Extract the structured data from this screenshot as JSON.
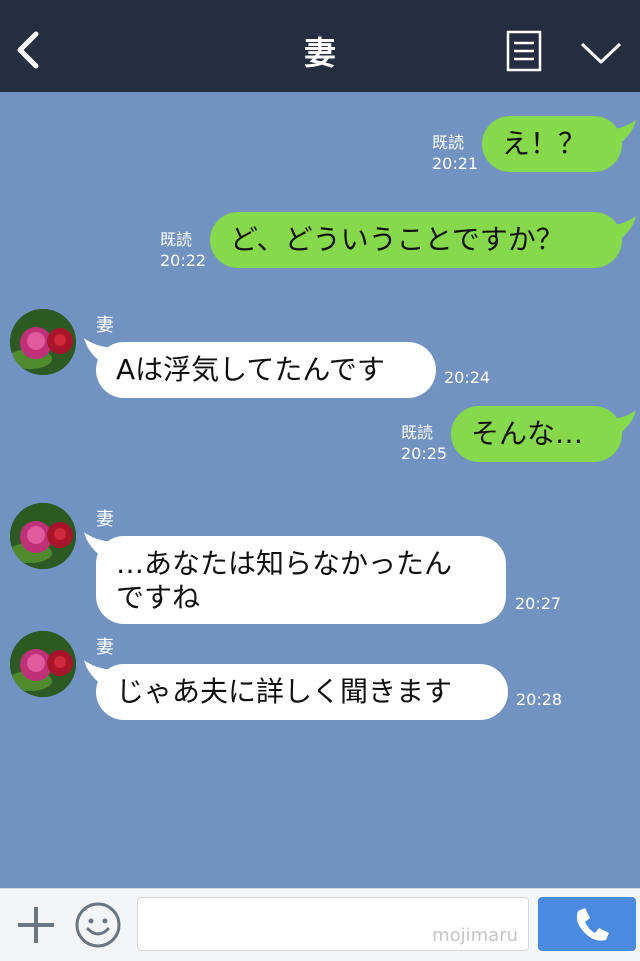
{
  "header": {
    "title": "妻"
  },
  "messages": [
    {
      "dir": "out",
      "text": "え！？",
      "read": "既読",
      "time": "20:21"
    },
    {
      "dir": "out",
      "text": "ど、どういうことですか？",
      "read": "既読",
      "time": "20:22"
    },
    {
      "dir": "in",
      "sender": "妻",
      "text": "Aは浮気してたんです",
      "time": "20:24"
    },
    {
      "dir": "out",
      "text": "そんな…",
      "read": "既読",
      "time": "20:25"
    },
    {
      "dir": "in",
      "sender": "妻",
      "text_line1": "…あなたは知らなかったん",
      "text_line2": "ですね",
      "time": "20:27"
    },
    {
      "dir": "in",
      "sender": "妻",
      "text": "じゃあ夫に詳しく聞きます",
      "time": "20:28"
    }
  ],
  "footer": {
    "input_value": "",
    "watermark": "mojimaru"
  },
  "colors": {
    "header": "#252d40",
    "chat_bg": "#7293c2",
    "bubble_out": "#86d94a",
    "bubble_in": "#ffffff",
    "call_button": "#4a8ae0"
  },
  "icons": [
    "back-icon",
    "menu-icon",
    "chevron-down-icon",
    "plus-icon",
    "emoji-icon",
    "phone-icon"
  ]
}
